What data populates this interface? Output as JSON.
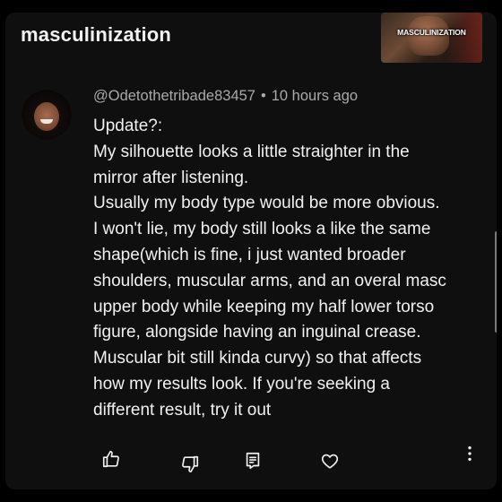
{
  "header": {
    "title": "masculinization",
    "thumbnail_label": "MASCULINIZATION"
  },
  "comment": {
    "author": "@Odetothetribade83457",
    "separator": "•",
    "time": "10 hours ago",
    "lines": [
      "Update?:",
      "My silhouette looks a little straighter in the",
      "mirror after listening.",
      "Usually my body type would be more obvious.",
      "I won't lie, my body still looks a like the same",
      "shape(which is fine, i just wanted broader",
      "shoulders, muscular arms, and an overal masc",
      "upper body while keeping my half lower torso",
      "figure, alongside having an inguinal crease.",
      "Muscular bit still kinda curvy) so that affects",
      "how my results look. If you're seeking a",
      "different result, try it out"
    ]
  },
  "actions": {
    "icons": [
      "thumbs-up-icon",
      "thumbs-down-icon",
      "comment-icon",
      "heart-icon",
      "more-vertical-icon"
    ]
  },
  "colors": {
    "background": "#0f0f0f",
    "text": "#f1f1f1",
    "meta": "#aaaaaa"
  }
}
